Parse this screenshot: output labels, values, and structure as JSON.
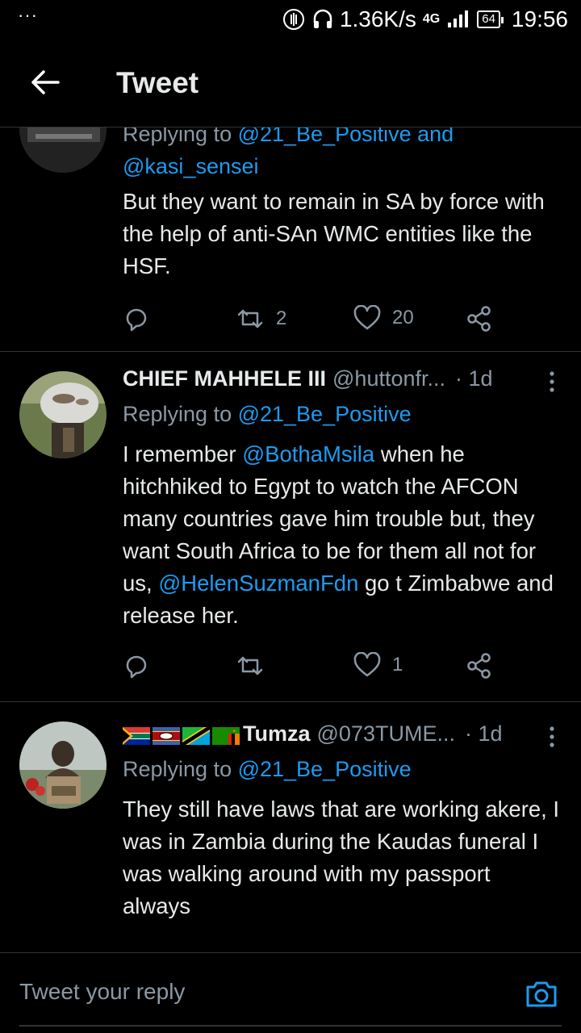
{
  "status_bar": {
    "dots": "···",
    "net_speed": "1.36K/s",
    "network": "4G",
    "battery": "64",
    "time": "19:56"
  },
  "header": {
    "title": "Tweet"
  },
  "tweets": [
    {
      "reply_prefix": "Replying to ",
      "reply_to_1": "@21_Be_Positive",
      "reply_joiner": " and",
      "reply_to_2": "@kasi_sensei",
      "text": "But they want to remain in SA by force with the help of anti-SAn WMC entities like the HSF.",
      "retweets": "2",
      "likes": "20"
    },
    {
      "name": "CHIEF MAHHELE III",
      "handle": "@huttonfr...",
      "time": "· 1d",
      "reply_prefix": "Replying to ",
      "reply_to": "@21_Be_Positive",
      "text_1": "I remember ",
      "mention_1": "@BothaMsila",
      "text_2": " when he hitchhiked to Egypt to watch the AFCON many countries gave him trouble but, they want South Africa to be for them all not for us, ",
      "mention_2": "@HelenSuzmanFdn",
      "text_3": " go t Zimbabwe and release her.",
      "retweets": "",
      "likes": "1"
    },
    {
      "name": "Tumza",
      "flags": [
        "south-africa-flag",
        "eswatini-flag",
        "tanzania-flag",
        "zambia-flag"
      ],
      "handle": "@073TUME...",
      "time": "· 1d",
      "reply_prefix": "Replying to ",
      "reply_to": "@21_Be_Positive",
      "text": "They still have laws that are working akere, I was in Zambia during the Kaudas funeral I was walking around with my passport always"
    }
  ],
  "reply_bar": {
    "placeholder": "Tweet your reply"
  },
  "colors": {
    "background": "#000000",
    "text": "#e7e9ea",
    "secondary": "#8b98a5",
    "link": "#1d9bf0",
    "divider": "#2f3336"
  }
}
